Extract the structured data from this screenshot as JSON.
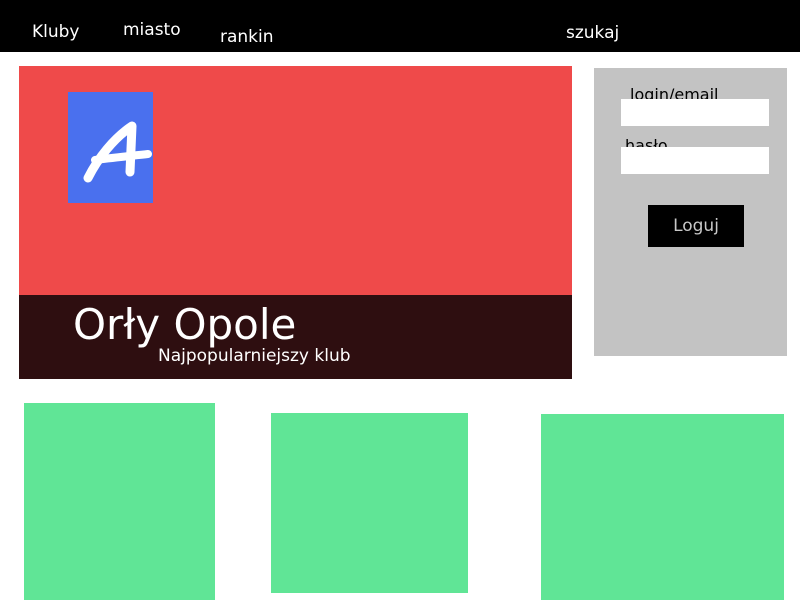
{
  "nav": {
    "items": [
      {
        "label": "Kluby"
      },
      {
        "label": "miasto"
      },
      {
        "label": "rankin"
      }
    ],
    "search_label": "szukaj"
  },
  "hero": {
    "logo_icon": "letter-a-logo-icon",
    "title": "Orły Opole",
    "subtitle": "Najpopularniejszy klub"
  },
  "login": {
    "login_label": "login/email",
    "login_value": "",
    "password_label": "hasło",
    "password_value": "",
    "button_label": "Loguj"
  },
  "tiles": [
    {
      "name": "tile-1"
    },
    {
      "name": "tile-2"
    },
    {
      "name": "tile-3"
    }
  ],
  "colors": {
    "topbar": "#000000",
    "hero": "#ef4a4a",
    "hero_band": "#2e0e10",
    "logo": "#4a70ee",
    "login_panel": "#c3c3c3",
    "tiles": "#60e596"
  }
}
